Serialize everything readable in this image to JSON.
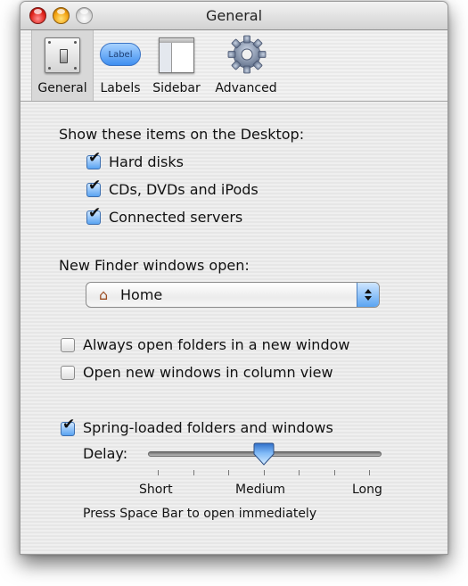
{
  "window": {
    "title": "General"
  },
  "toolbar": {
    "items": [
      {
        "label": "General",
        "icon": "light-switch-icon",
        "selected": true
      },
      {
        "label": "Labels",
        "icon": "label-tag-icon",
        "badge_text": "Label",
        "selected": false
      },
      {
        "label": "Sidebar",
        "icon": "sidebar-window-icon",
        "selected": false
      },
      {
        "label": "Advanced",
        "icon": "gear-icon",
        "selected": false
      }
    ]
  },
  "desktop_section": {
    "heading": "Show these items on the Desktop:",
    "items": [
      {
        "label": "Hard disks",
        "checked": true
      },
      {
        "label": "CDs, DVDs and iPods",
        "checked": true
      },
      {
        "label": "Connected servers",
        "checked": true
      }
    ]
  },
  "new_window_section": {
    "heading": "New Finder windows open:",
    "selected_value": "Home",
    "icon": "home-icon"
  },
  "window_options": [
    {
      "label": "Always open folders in a new window",
      "checked": false
    },
    {
      "label": "Open new windows in column view",
      "checked": false
    }
  ],
  "spring_loaded": {
    "label": "Spring-loaded folders and windows",
    "checked": true,
    "delay_label": "Delay:",
    "slider": {
      "value_fraction": 0.5,
      "tick_count": 7,
      "labels": [
        "Short",
        "Medium",
        "Long"
      ]
    },
    "hint": "Press Space Bar to open immediately"
  },
  "colors": {
    "accent_blue": "#5aa4f2",
    "close": "#e0231b",
    "minimize": "#f3a20f"
  }
}
